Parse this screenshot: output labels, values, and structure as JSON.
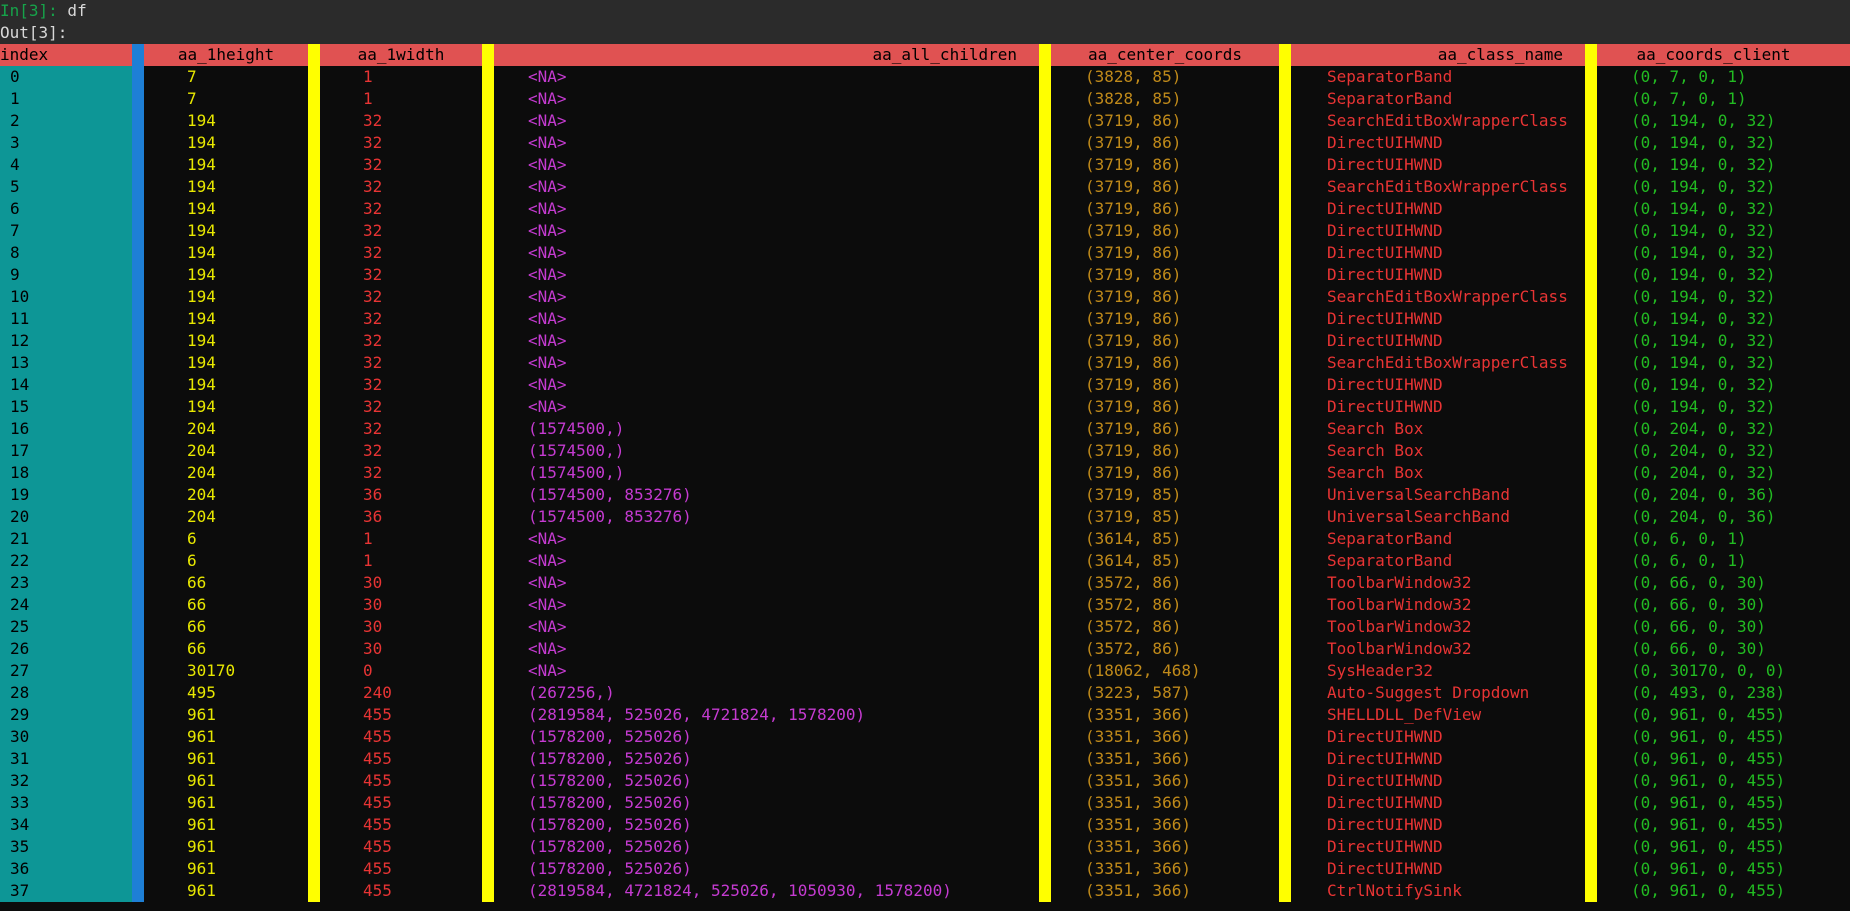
{
  "prompt": {
    "in_label": "In[3]:",
    "command": " df",
    "out_label": "Out[3]:"
  },
  "columns": {
    "index": "index",
    "height": "aa_1height",
    "width": "aa_1width",
    "children": "aa_all_children",
    "center": "aa_center_coords",
    "class_name": "aa_class_name",
    "client": "aa_coords_client"
  },
  "colors": {
    "header_bg": "#e05252",
    "index_bg": "#0d9696",
    "separator": "#ffff00",
    "index_separator": "#1e7fd6",
    "height_text": "#e8e800",
    "width_text": "#e83434",
    "children_text": "#c53bd1",
    "center_text": "#c08a1a",
    "class_text": "#e83434",
    "client_text": "#22bb22"
  },
  "rows": [
    [
      "0",
      "7",
      "1",
      "<NA>",
      "(3828, 85)",
      "SeparatorBand",
      "(0, 7, 0, 1)"
    ],
    [
      "1",
      "7",
      "1",
      "<NA>",
      "(3828, 85)",
      "SeparatorBand",
      "(0, 7, 0, 1)"
    ],
    [
      "2",
      "194",
      "32",
      "<NA>",
      "(3719, 86)",
      "SearchEditBoxWrapperClass",
      "(0, 194, 0, 32)"
    ],
    [
      "3",
      "194",
      "32",
      "<NA>",
      "(3719, 86)",
      "DirectUIHWND",
      "(0, 194, 0, 32)"
    ],
    [
      "4",
      "194",
      "32",
      "<NA>",
      "(3719, 86)",
      "DirectUIHWND",
      "(0, 194, 0, 32)"
    ],
    [
      "5",
      "194",
      "32",
      "<NA>",
      "(3719, 86)",
      "SearchEditBoxWrapperClass",
      "(0, 194, 0, 32)"
    ],
    [
      "6",
      "194",
      "32",
      "<NA>",
      "(3719, 86)",
      "DirectUIHWND",
      "(0, 194, 0, 32)"
    ],
    [
      "7",
      "194",
      "32",
      "<NA>",
      "(3719, 86)",
      "DirectUIHWND",
      "(0, 194, 0, 32)"
    ],
    [
      "8",
      "194",
      "32",
      "<NA>",
      "(3719, 86)",
      "DirectUIHWND",
      "(0, 194, 0, 32)"
    ],
    [
      "9",
      "194",
      "32",
      "<NA>",
      "(3719, 86)",
      "DirectUIHWND",
      "(0, 194, 0, 32)"
    ],
    [
      "10",
      "194",
      "32",
      "<NA>",
      "(3719, 86)",
      "SearchEditBoxWrapperClass",
      "(0, 194, 0, 32)"
    ],
    [
      "11",
      "194",
      "32",
      "<NA>",
      "(3719, 86)",
      "DirectUIHWND",
      "(0, 194, 0, 32)"
    ],
    [
      "12",
      "194",
      "32",
      "<NA>",
      "(3719, 86)",
      "DirectUIHWND",
      "(0, 194, 0, 32)"
    ],
    [
      "13",
      "194",
      "32",
      "<NA>",
      "(3719, 86)",
      "SearchEditBoxWrapperClass",
      "(0, 194, 0, 32)"
    ],
    [
      "14",
      "194",
      "32",
      "<NA>",
      "(3719, 86)",
      "DirectUIHWND",
      "(0, 194, 0, 32)"
    ],
    [
      "15",
      "194",
      "32",
      "<NA>",
      "(3719, 86)",
      "DirectUIHWND",
      "(0, 194, 0, 32)"
    ],
    [
      "16",
      "204",
      "32",
      "(1574500,)",
      "(3719, 86)",
      "Search Box",
      "(0, 204, 0, 32)"
    ],
    [
      "17",
      "204",
      "32",
      "(1574500,)",
      "(3719, 86)",
      "Search Box",
      "(0, 204, 0, 32)"
    ],
    [
      "18",
      "204",
      "32",
      "(1574500,)",
      "(3719, 86)",
      "Search Box",
      "(0, 204, 0, 32)"
    ],
    [
      "19",
      "204",
      "36",
      "(1574500, 853276)",
      "(3719, 85)",
      "UniversalSearchBand",
      "(0, 204, 0, 36)"
    ],
    [
      "20",
      "204",
      "36",
      "(1574500, 853276)",
      "(3719, 85)",
      "UniversalSearchBand",
      "(0, 204, 0, 36)"
    ],
    [
      "21",
      "6",
      "1",
      "<NA>",
      "(3614, 85)",
      "SeparatorBand",
      "(0, 6, 0, 1)"
    ],
    [
      "22",
      "6",
      "1",
      "<NA>",
      "(3614, 85)",
      "SeparatorBand",
      "(0, 6, 0, 1)"
    ],
    [
      "23",
      "66",
      "30",
      "<NA>",
      "(3572, 86)",
      "ToolbarWindow32",
      "(0, 66, 0, 30)"
    ],
    [
      "24",
      "66",
      "30",
      "<NA>",
      "(3572, 86)",
      "ToolbarWindow32",
      "(0, 66, 0, 30)"
    ],
    [
      "25",
      "66",
      "30",
      "<NA>",
      "(3572, 86)",
      "ToolbarWindow32",
      "(0, 66, 0, 30)"
    ],
    [
      "26",
      "66",
      "30",
      "<NA>",
      "(3572, 86)",
      "ToolbarWindow32",
      "(0, 66, 0, 30)"
    ],
    [
      "27",
      "30170",
      "0",
      "<NA>",
      "(18062, 468)",
      "SysHeader32",
      "(0, 30170, 0, 0)"
    ],
    [
      "28",
      "495",
      "240",
      "(267256,)",
      "(3223, 587)",
      "Auto-Suggest Dropdown",
      "(0, 493, 0, 238)"
    ],
    [
      "29",
      "961",
      "455",
      "(2819584, 525026, 4721824, 1578200)",
      "(3351, 366)",
      "SHELLDLL_DefView",
      "(0, 961, 0, 455)"
    ],
    [
      "30",
      "961",
      "455",
      "(1578200, 525026)",
      "(3351, 366)",
      "DirectUIHWND",
      "(0, 961, 0, 455)"
    ],
    [
      "31",
      "961",
      "455",
      "(1578200, 525026)",
      "(3351, 366)",
      "DirectUIHWND",
      "(0, 961, 0, 455)"
    ],
    [
      "32",
      "961",
      "455",
      "(1578200, 525026)",
      "(3351, 366)",
      "DirectUIHWND",
      "(0, 961, 0, 455)"
    ],
    [
      "33",
      "961",
      "455",
      "(1578200, 525026)",
      "(3351, 366)",
      "DirectUIHWND",
      "(0, 961, 0, 455)"
    ],
    [
      "34",
      "961",
      "455",
      "(1578200, 525026)",
      "(3351, 366)",
      "DirectUIHWND",
      "(0, 961, 0, 455)"
    ],
    [
      "35",
      "961",
      "455",
      "(1578200, 525026)",
      "(3351, 366)",
      "DirectUIHWND",
      "(0, 961, 0, 455)"
    ],
    [
      "36",
      "961",
      "455",
      "(1578200, 525026)",
      "(3351, 366)",
      "DirectUIHWND",
      "(0, 961, 0, 455)"
    ],
    [
      "37",
      "961",
      "455",
      "(2819584, 4721824, 525026, 1050930, 1578200)",
      "(3351, 366)",
      "CtrlNotifySink",
      "(0, 961, 0, 455)"
    ]
  ]
}
